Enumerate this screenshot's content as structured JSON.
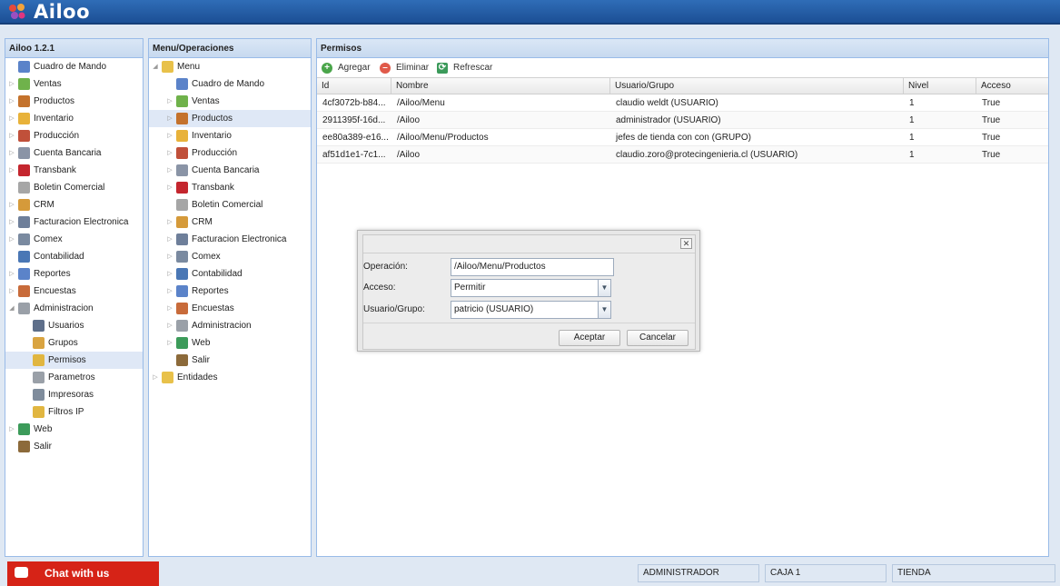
{
  "app": {
    "logo_text": "Ailoo"
  },
  "left_panel": {
    "title": "Ailoo 1.2.1",
    "items": [
      {
        "label": "Cuadro de Mando",
        "icon": "chart-icon",
        "color": "#5b83c9"
      },
      {
        "label": "Ventas",
        "icon": "tag-icon",
        "color": "#6fb24b"
      },
      {
        "label": "Productos",
        "icon": "box-icon",
        "color": "#c4722c"
      },
      {
        "label": "Inventario",
        "icon": "cube-icon",
        "color": "#e8b23a"
      },
      {
        "label": "Producción",
        "icon": "factory-icon",
        "color": "#c0503a"
      },
      {
        "label": "Cuenta Bancaria",
        "icon": "bank-icon",
        "color": "#8a94a6"
      },
      {
        "label": "Transbank",
        "icon": "transbank-icon",
        "color": "#c4262e"
      },
      {
        "label": "Boletin Comercial",
        "icon": "tag-gray-icon",
        "color": "#a6a6a6"
      },
      {
        "label": "CRM",
        "icon": "people-icon",
        "color": "#d59a3a"
      },
      {
        "label": "Facturacion Electronica",
        "icon": "invoice-icon",
        "color": "#6e7f9a"
      },
      {
        "label": "Comex",
        "icon": "truck-icon",
        "color": "#7a8aa0"
      },
      {
        "label": "Contabilidad",
        "icon": "calculator-icon",
        "color": "#4a77b5"
      },
      {
        "label": "Reportes",
        "icon": "report-icon",
        "color": "#5b83c9"
      },
      {
        "label": "Encuestas",
        "icon": "survey-icon",
        "color": "#c86b3a"
      },
      {
        "label": "Administracion",
        "icon": "gear-icon",
        "color": "#9aa0a8"
      },
      {
        "label": "Usuarios",
        "icon": "user-icon",
        "color": "#5e6f8a"
      },
      {
        "label": "Grupos",
        "icon": "group-icon",
        "color": "#d9a441"
      },
      {
        "label": "Permisos",
        "icon": "lock-icon",
        "color": "#e1b640"
      },
      {
        "label": "Parametros",
        "icon": "gear-icon",
        "color": "#9aa0a8"
      },
      {
        "label": "Impresoras",
        "icon": "printer-icon",
        "color": "#7f8c9c"
      },
      {
        "label": "Filtros IP",
        "icon": "lock-icon",
        "color": "#e1b640"
      },
      {
        "label": "Web",
        "icon": "globe-icon",
        "color": "#3c9b5a"
      },
      {
        "label": "Salir",
        "icon": "door-icon",
        "color": "#8c6a3a"
      }
    ]
  },
  "mid_panel": {
    "title": "Menu/Operaciones",
    "items": [
      {
        "label": "Menu",
        "icon": "folder-open-icon",
        "color": "#e8c14a"
      },
      {
        "label": "Cuadro de Mando",
        "icon": "chart-icon",
        "color": "#5b83c9"
      },
      {
        "label": "Ventas",
        "icon": "tag-icon",
        "color": "#6fb24b"
      },
      {
        "label": "Productos",
        "icon": "box-icon",
        "color": "#c4722c"
      },
      {
        "label": "Inventario",
        "icon": "cube-icon",
        "color": "#e8b23a"
      },
      {
        "label": "Producción",
        "icon": "factory-icon",
        "color": "#c0503a"
      },
      {
        "label": "Cuenta Bancaria",
        "icon": "bank-icon",
        "color": "#8a94a6"
      },
      {
        "label": "Transbank",
        "icon": "transbank-icon",
        "color": "#c4262e"
      },
      {
        "label": "Boletin Comercial",
        "icon": "tag-gray-icon",
        "color": "#a6a6a6"
      },
      {
        "label": "CRM",
        "icon": "people-icon",
        "color": "#d59a3a"
      },
      {
        "label": "Facturacion Electronica",
        "icon": "invoice-icon",
        "color": "#6e7f9a"
      },
      {
        "label": "Comex",
        "icon": "truck-icon",
        "color": "#7a8aa0"
      },
      {
        "label": "Contabilidad",
        "icon": "calculator-icon",
        "color": "#4a77b5"
      },
      {
        "label": "Reportes",
        "icon": "report-icon",
        "color": "#5b83c9"
      },
      {
        "label": "Encuestas",
        "icon": "survey-icon",
        "color": "#c86b3a"
      },
      {
        "label": "Administracion",
        "icon": "gear-icon",
        "color": "#9aa0a8"
      },
      {
        "label": "Web",
        "icon": "globe-icon",
        "color": "#3c9b5a"
      },
      {
        "label": "Salir",
        "icon": "door-icon",
        "color": "#8c6a3a"
      },
      {
        "label": "Entidades",
        "icon": "folder-icon",
        "color": "#e8c14a"
      }
    ]
  },
  "permisos": {
    "title": "Permisos",
    "toolbar": {
      "add_label": "Agregar",
      "delete_label": "Eliminar",
      "refresh_label": "Refrescar"
    },
    "columns": [
      "Id",
      "Nombre",
      "Usuario/Grupo",
      "Nivel",
      "Acceso"
    ],
    "rows": [
      [
        "4cf3072b-b84...",
        "/Ailoo/Menu",
        "claudio weldt (USUARIO)",
        "1",
        "True"
      ],
      [
        "2911395f-16d...",
        "/Ailoo",
        "administrador (USUARIO)",
        "1",
        "True"
      ],
      [
        "ee80a389-e16...",
        "/Ailoo/Menu/Productos",
        "jefes de tienda con con (GRUPO)",
        "1",
        "True"
      ],
      [
        "af51d1e1-7c1...",
        "/Ailoo",
        "claudio.zoro@protecingenieria.cl (USUARIO)",
        "1",
        "True"
      ]
    ]
  },
  "dialog": {
    "operacion_label": "Operación:",
    "operacion_value": "/Ailoo/Menu/Productos",
    "acceso_label": "Acceso:",
    "acceso_value": "Permitir",
    "usuario_label": "Usuario/Grupo:",
    "usuario_value": "patricio (USUARIO)",
    "accept_label": "Aceptar",
    "cancel_label": "Cancelar"
  },
  "footer": {
    "chat_label": "Chat with us",
    "status_user": "ADMINISTRADOR",
    "status_caja": "CAJA 1",
    "status_tienda": "TIENDA"
  },
  "colors": {
    "header": "#1c4f95",
    "accent": "#99bbe8",
    "chat": "#d62317"
  }
}
